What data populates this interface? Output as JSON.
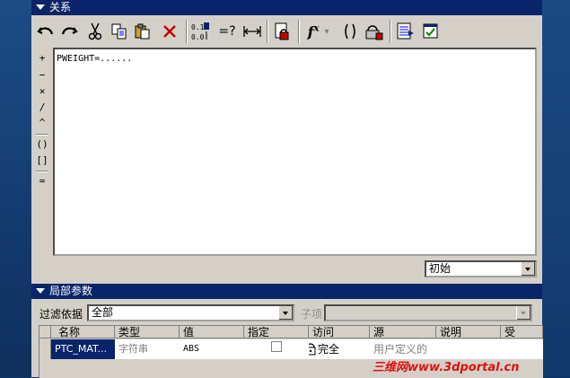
{
  "relations_header": {
    "title": "关系"
  },
  "toolbar": {
    "items": [
      {
        "name": "undo-icon",
        "glyph": "↶"
      },
      {
        "name": "redo-icon",
        "glyph": "↷"
      },
      {
        "name": "cut-icon",
        "glyph": "✂"
      },
      {
        "name": "copy-icon",
        "glyph": "⎘"
      },
      {
        "name": "paste-icon",
        "glyph": "📋"
      },
      {
        "name": "delete-icon",
        "glyph": "✕"
      },
      {
        "name": "sort-icon",
        "glyph": "⇅"
      },
      {
        "name": "evaluate-icon",
        "glyph": "=?"
      },
      {
        "name": "dimension-icon",
        "glyph": "⟷"
      },
      {
        "name": "lock-icon",
        "glyph": "🔒"
      },
      {
        "name": "function-icon",
        "glyph": "fx"
      },
      {
        "name": "dropdown-icon",
        "glyph": "▾"
      },
      {
        "name": "brackets-icon",
        "glyph": "()"
      },
      {
        "name": "lock-parameter-icon",
        "glyph": "🔒"
      },
      {
        "name": "insert-icon",
        "glyph": "☰"
      },
      {
        "name": "verify-icon",
        "glyph": "☑"
      }
    ]
  },
  "operators": [
    "+",
    "−",
    "×",
    "/",
    "^",
    "()",
    "[]",
    "="
  ],
  "editor": {
    "text": "PWEIGHT=......"
  },
  "scope_select": {
    "value": "初始"
  },
  "local_params_header": {
    "title": "局部参数"
  },
  "filter": {
    "label": "过滤依据",
    "value": "全部",
    "subitem_label": "子项",
    "subitem_value": ""
  },
  "table": {
    "columns": [
      "名称",
      "类型",
      "值",
      "指定",
      "访问",
      "源",
      "说明",
      "受"
    ],
    "rows": [
      {
        "name": "PTC_MAT...",
        "type": "字符串",
        "value": "ABS",
        "designated": false,
        "access": "完全",
        "source": "用户定义的",
        "description": "",
        "restricted": ""
      }
    ]
  },
  "watermark": {
    "text": "三维网www.3dportal.cn"
  },
  "colors": {
    "title_bar": "#0a246a",
    "dialog_bg": "#d4d0c8",
    "watermark": "#e01010"
  }
}
